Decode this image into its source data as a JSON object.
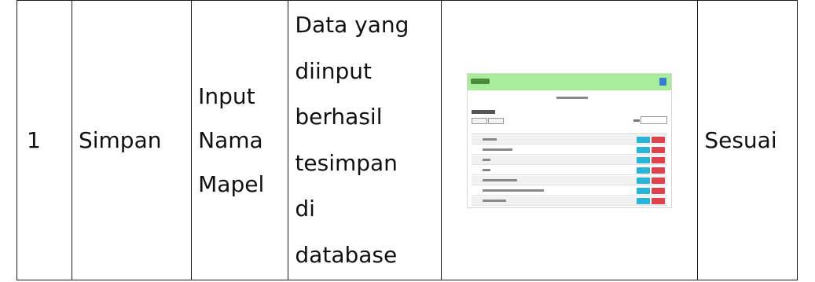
{
  "row": {
    "number": "1",
    "action": "Simpan",
    "input": [
      "Input",
      "Nama",
      "Mapel"
    ],
    "expected_result": [
      "Data yang",
      "diinput",
      "berhasil",
      "tesimpan",
      "di",
      "database"
    ],
    "status": "Sesuai"
  },
  "screenshot": {
    "colors": {
      "header": "#a8ee9a",
      "edit_button": "#27b6d8",
      "delete_button": "#e0424b"
    },
    "row_count": 7
  }
}
